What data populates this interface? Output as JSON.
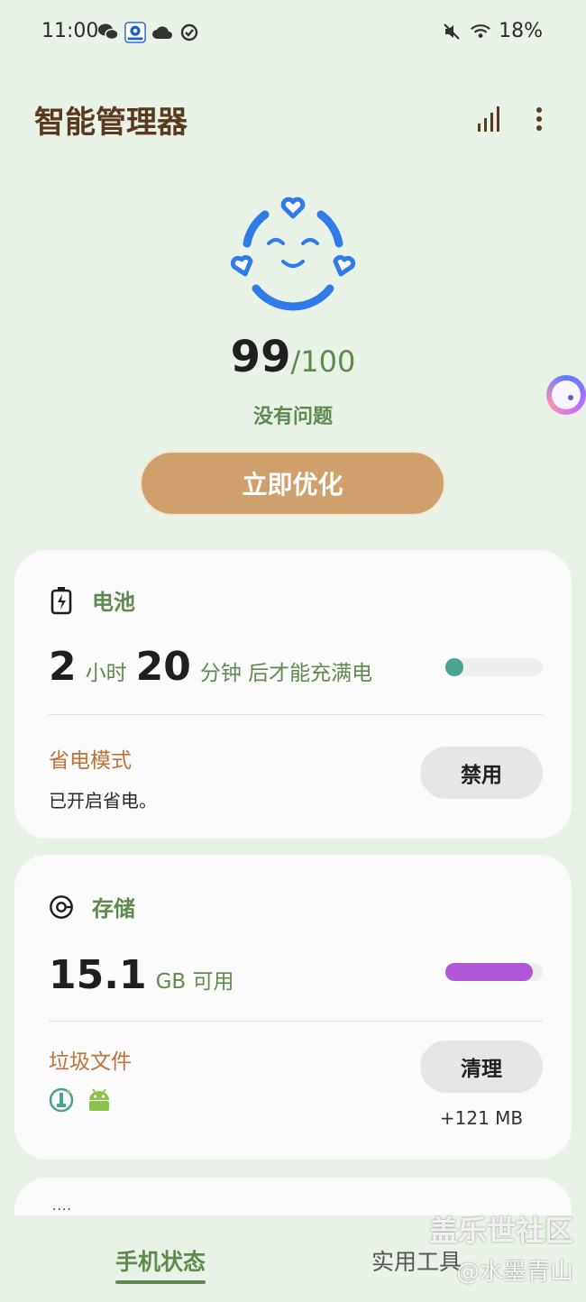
{
  "status_bar": {
    "time": "11:00",
    "battery": "18%",
    "left_icons": [
      "wechat-icon",
      "app-notification-icon",
      "cloud-icon",
      "task-check-icon"
    ],
    "right_icons": [
      "mute-icon",
      "wifi-icon"
    ]
  },
  "header": {
    "title": "智能管理器",
    "icons": [
      "signal-stats-icon",
      "more-options-icon"
    ]
  },
  "score": {
    "value": "99",
    "max": "/100",
    "status": "没有问题"
  },
  "optimize_button": "立即优化",
  "battery_card": {
    "title": "电池",
    "hours": "2",
    "hours_unit": "小时",
    "minutes": "20",
    "minutes_unit": "分钟 后才能充满电",
    "level_fraction": 0.18,
    "bar_color": "#4aa391",
    "power_saving_title": "省电模式",
    "power_saving_status": "已开启省电。",
    "disable_button": "禁用"
  },
  "storage_card": {
    "title": "存储",
    "available": "15.1",
    "available_unit": "GB 可用",
    "used_fraction": 0.9,
    "bar_color": "#b057d8",
    "junk_title": "垃圾文件",
    "junk_icons": [
      "cleaner-app-icon",
      "android-icon"
    ],
    "clean_button": "清理",
    "junk_size": "+121 MB"
  },
  "third_card": {
    "label": "...."
  },
  "bottom_nav": {
    "tabs": [
      {
        "label": "手机状态",
        "active": true
      },
      {
        "label": "实用工具",
        "active": false
      }
    ]
  },
  "watermark": {
    "line1": "盖乐世社区",
    "line2": "@水墨青山"
  },
  "colors": {
    "background": "#e9f2e6",
    "accent_green": "#5f8a4f",
    "title_brown": "#5a3a1e",
    "button_tan": "#d0a06c",
    "sub_orange": "#c0713a",
    "face_blue": "#2f7be8"
  }
}
